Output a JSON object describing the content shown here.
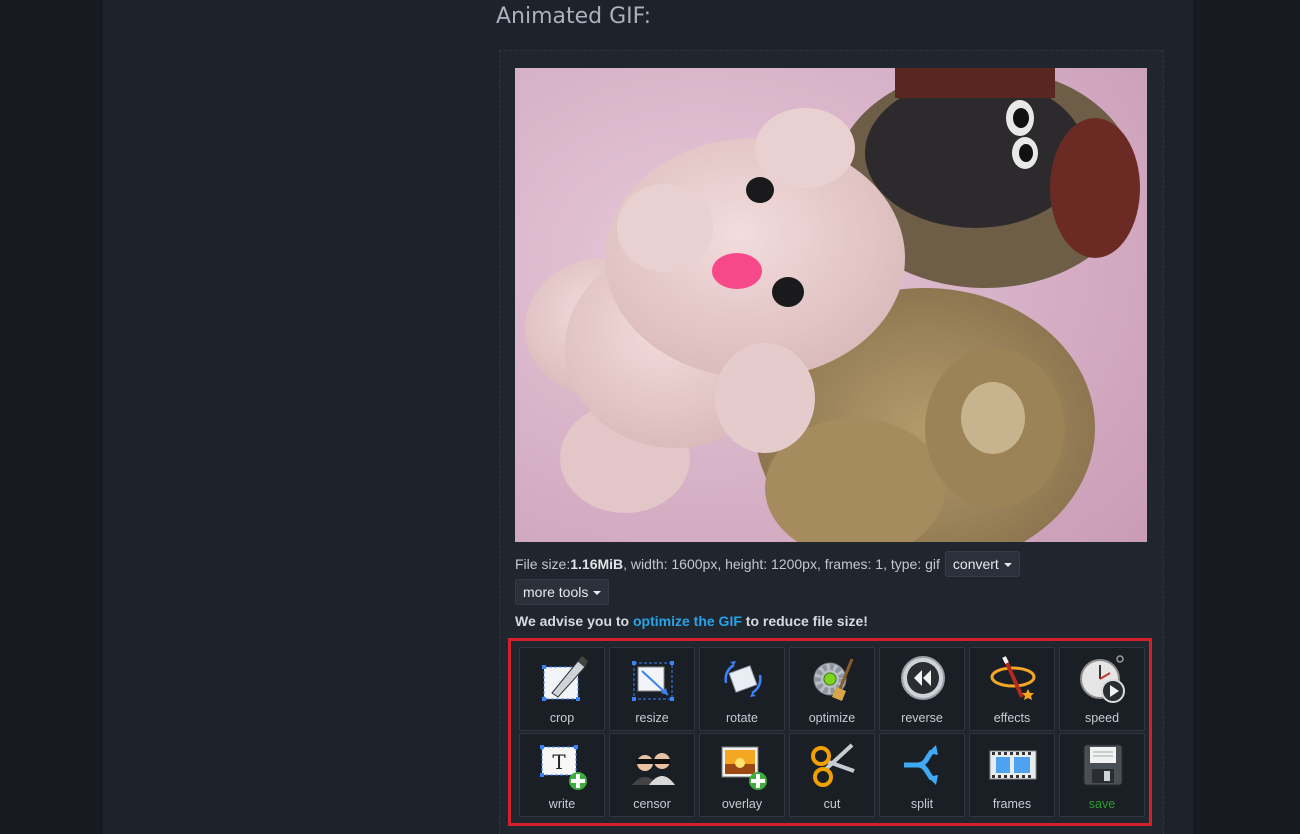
{
  "page": {
    "heading": "Animated GIF:"
  },
  "file_info": {
    "size_label": "File size: ",
    "size_value": "1.16MiB",
    "details": ", width: 1600px, height: 1200px, frames: 1, type: gif"
  },
  "buttons": {
    "convert_label": "convert",
    "more_tools_label": "more tools"
  },
  "advice": {
    "prefix": "We advise you to ",
    "link_text": "optimize the GIF",
    "suffix": " to reduce file size!"
  },
  "tools": {
    "row1": [
      {
        "label": "crop",
        "icon": "crop-icon"
      },
      {
        "label": "resize",
        "icon": "resize-icon"
      },
      {
        "label": "rotate",
        "icon": "rotate-icon"
      },
      {
        "label": "optimize",
        "icon": "optimize-icon"
      },
      {
        "label": "reverse",
        "icon": "reverse-icon"
      },
      {
        "label": "effects",
        "icon": "effects-icon"
      },
      {
        "label": "speed",
        "icon": "speed-icon"
      }
    ],
    "row2": [
      {
        "label": "write",
        "icon": "write-icon"
      },
      {
        "label": "censor",
        "icon": "censor-icon"
      },
      {
        "label": "overlay",
        "icon": "overlay-icon"
      },
      {
        "label": "cut",
        "icon": "cut-icon"
      },
      {
        "label": "split",
        "icon": "split-icon"
      },
      {
        "label": "frames",
        "icon": "frames-icon"
      },
      {
        "label": "save",
        "icon": "save-icon"
      }
    ]
  },
  "colors": {
    "highlight_border": "#d41f2c",
    "link": "#29a3e8",
    "save_label": "#2f9a2f"
  }
}
